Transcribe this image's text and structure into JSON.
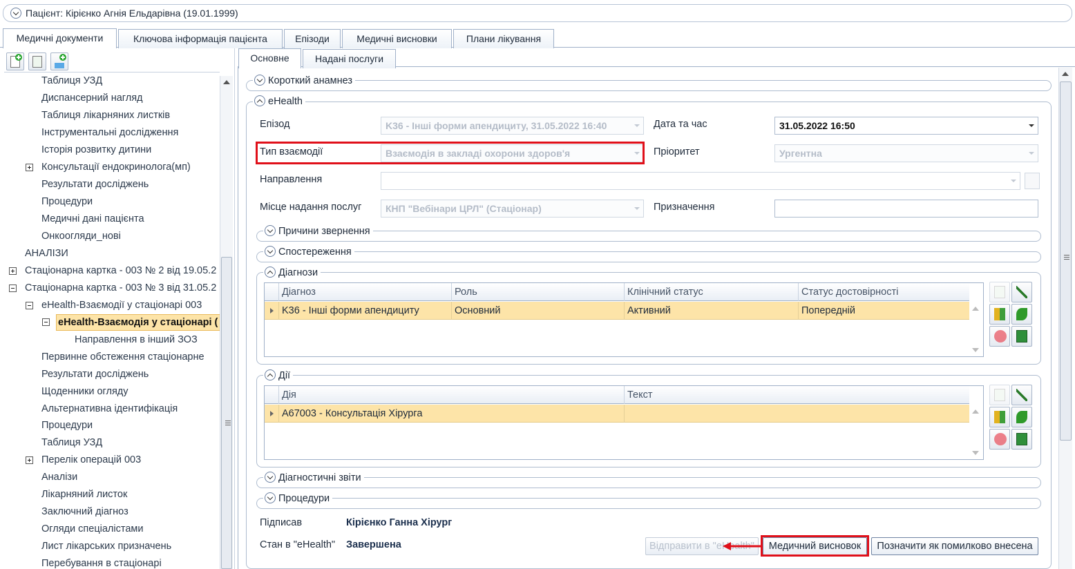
{
  "patient": {
    "title": "Пацієнт: Кірієнко Агнія Ельдарівна (19.01.1999)"
  },
  "main_tabs": [
    {
      "label": "Медичні документи",
      "active": true
    },
    {
      "label": "Ключова інформація пацієнта",
      "active": false
    },
    {
      "label": "Епізоди",
      "active": false
    },
    {
      "label": "Медичні висновки",
      "active": false
    },
    {
      "label": "Плани лікування",
      "active": false
    }
  ],
  "toolbar": {
    "icons": [
      "add-document-icon",
      "add-copy-icon",
      "add-item-icon"
    ]
  },
  "tree": {
    "items": [
      {
        "label": "Таблиця УЗД"
      },
      {
        "label": "Диспансерний нагляд"
      },
      {
        "label": "Таблиця лікарняних листків"
      },
      {
        "label": "Інструментальні дослідження"
      },
      {
        "label": "Історія розвитку дитини"
      },
      {
        "label": "Консультації ендокринолога(мп)"
      },
      {
        "label": "Результати досліджень"
      },
      {
        "label": "Процедури"
      },
      {
        "label": "Медичні дані пацієнта"
      },
      {
        "label": "Онкоогляди_нові"
      },
      {
        "label": "АНАЛІЗИ"
      },
      {
        "label": "Стаціонарна картка - 003 № 2 від 19.05.2"
      },
      {
        "label": "Стаціонарна картка - 003 № 3 від 31.05.2"
      },
      {
        "label": "eHealth-Взаємодії у стаціонарі 003"
      },
      {
        "label": "eHealth-Взаємодія у стаціонарі ("
      },
      {
        "label": "Направлення в інший ЗОЗ"
      },
      {
        "label": "Первинне обстеження стаціонарне"
      },
      {
        "label": "Результати досліджень"
      },
      {
        "label": "Щоденники огляду"
      },
      {
        "label": "Альтернативна ідентифікація"
      },
      {
        "label": "Процедури"
      },
      {
        "label": "Таблиця УЗД"
      },
      {
        "label": "Перелік операцій 003"
      },
      {
        "label": "Аналізи"
      },
      {
        "label": "Лікарняний листок"
      },
      {
        "label": "Заключний діагноз"
      },
      {
        "label": "Огляди спеціалістами"
      },
      {
        "label": "Лист лікарських призначень"
      },
      {
        "label": "Перебування в стаціонарі"
      }
    ]
  },
  "sub_tabs": [
    {
      "label": "Основне",
      "active": true
    },
    {
      "label": "Надані послуги",
      "active": false
    }
  ],
  "sections": {
    "short_anamnesis": "Короткий анамнез",
    "ehealth": "eHealth",
    "reasons": "Причини звернення",
    "observations": "Спостереження",
    "diagnoses": "Діагнози",
    "actions": "Дії",
    "diag_reports": "Діагностичні звіти",
    "procedures": "Процедури"
  },
  "form": {
    "episode_label": "Епізод",
    "episode_value": "K36 - Інші форми апендициту, 31.05.2022 16:40",
    "datetime_label": "Дата та час",
    "datetime_value": "31.05.2022 16:50",
    "interaction_type_label": "Тип взаємодії",
    "interaction_type_value": "Взаємодія в закладі охорони здоров'я",
    "priority_label": "Пріоритет",
    "priority_value": "Ургентна",
    "referral_label": "Направлення",
    "referral_value": "",
    "place_label": "Місце надання послуг",
    "place_value": "КНП \"Вебінари ЦРЛ\" (Стаціонар)",
    "purpose_label": "Призначення",
    "purpose_value": ""
  },
  "diagnoses_grid": {
    "columns": [
      "Діагноз",
      "Роль",
      "Клінічний статус",
      "Статус достовірності"
    ],
    "rows": [
      [
        "K36 - Інші форми апендициту",
        "Основний",
        "Активний",
        "Попередній"
      ]
    ]
  },
  "actions_grid": {
    "columns": [
      "Дія",
      "Текст"
    ],
    "rows": [
      [
        "A67003 - Консультація Хірурга",
        ""
      ]
    ]
  },
  "footer": {
    "signed_label": "Підписав",
    "signed_value": "Кірієнко Ганна Хірург",
    "state_label": "Стан в \"eHealth\"",
    "state_value": "Завершена",
    "send_button": "Відправити в \"eHealth\"",
    "conclusion_button": "Медичний висновок",
    "mark_error_button": "Позначити як помилково внесена"
  },
  "colors": {
    "selection": "#fde4a8",
    "highlight_box": "#e0101a",
    "border": "#aebccf"
  }
}
